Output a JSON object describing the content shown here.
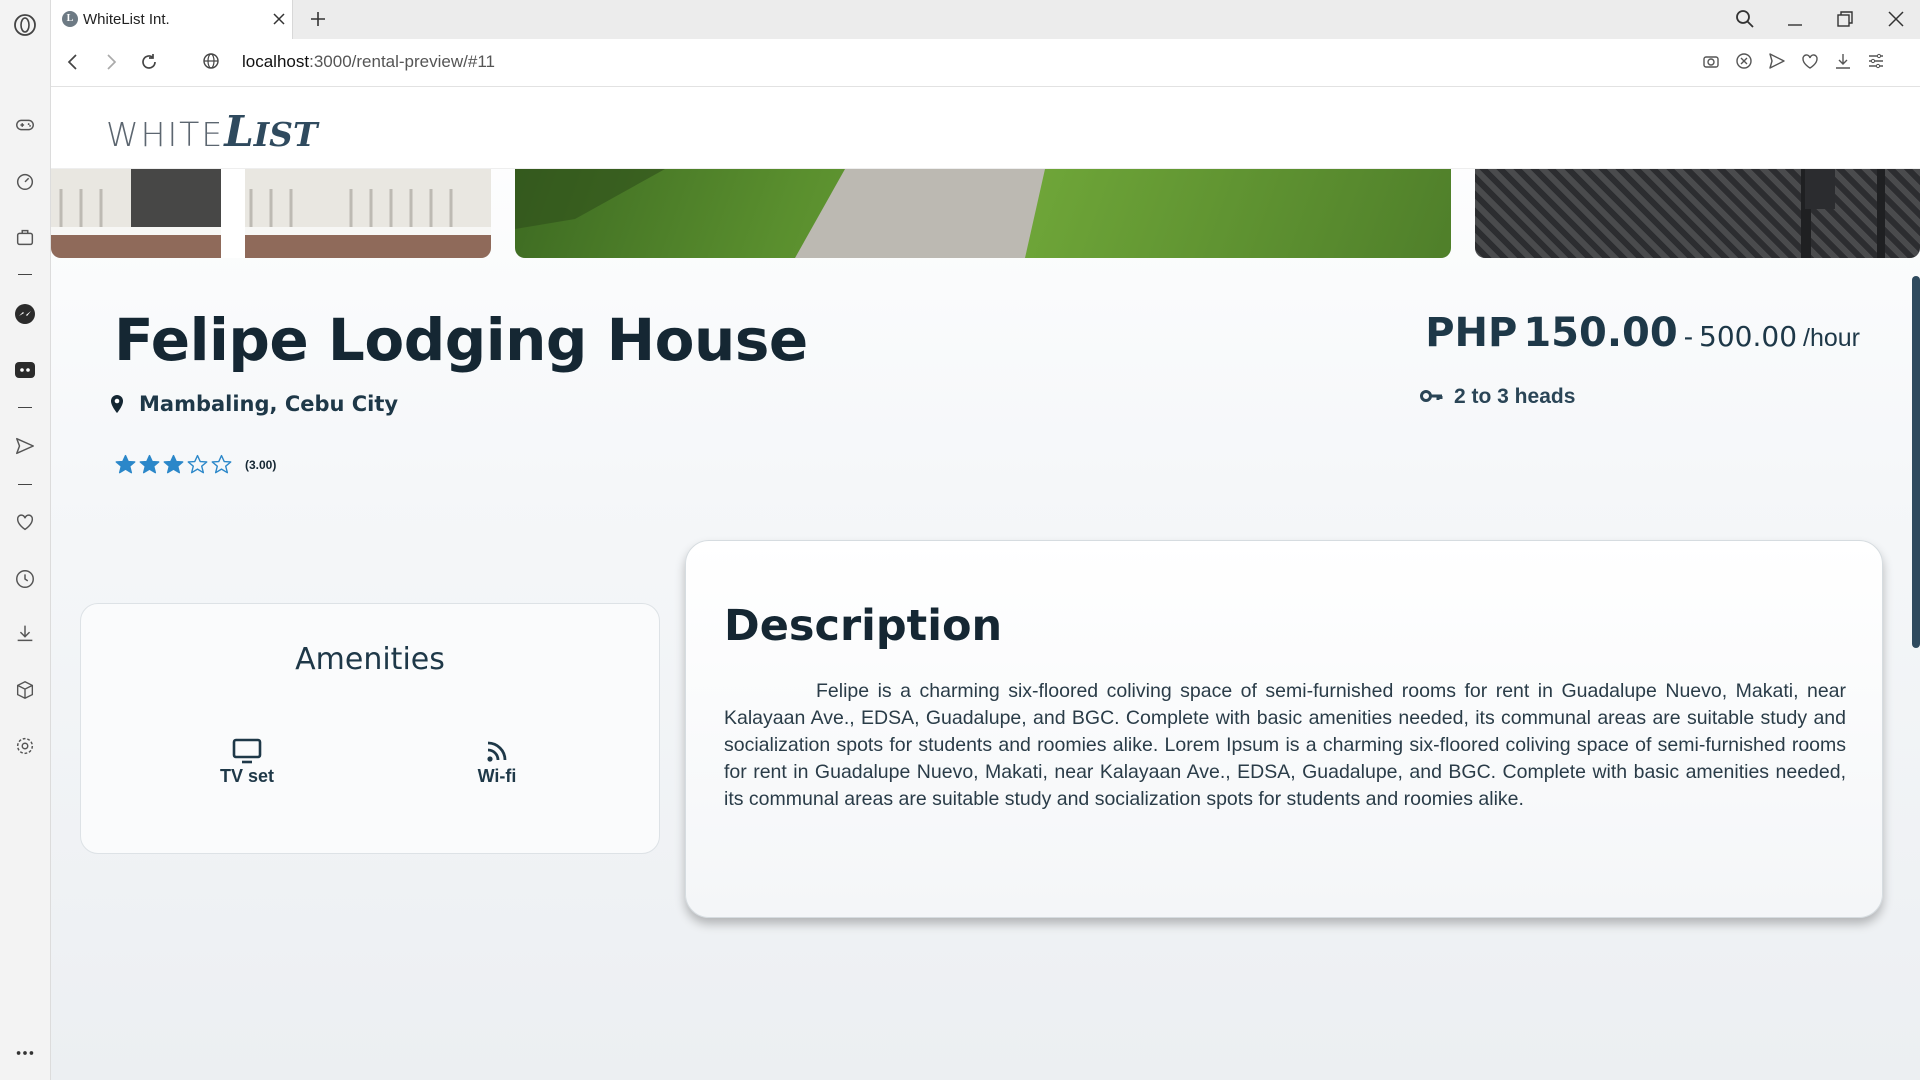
{
  "browser": {
    "tab_title": "WhiteList Int.",
    "url_host": "localhost",
    "url_path": ":3000/rental-preview/#11"
  },
  "site": {
    "logo_part1": "WHITE",
    "logo_part2": "L",
    "logo_part3": "IST"
  },
  "listing": {
    "title": "Felipe Lodging House",
    "location": "Mambaling, Cebu City",
    "rating_text": "(3.00)",
    "rating_value": 3,
    "rating_max": 5,
    "price_currency": "PHP",
    "price_min": "150.00",
    "price_sep": "-",
    "price_max": "500.00",
    "price_unit": "/hour",
    "heads": "2 to 3 heads"
  },
  "amenities": {
    "title": "Amenities",
    "items": [
      {
        "label": "TV set",
        "icon": "tv-icon"
      },
      {
        "label": "Wi-fi",
        "icon": "wifi-icon"
      }
    ]
  },
  "description": {
    "title": "Description",
    "text": "Felipe is a charming six-floored coliving space of semi-furnished rooms for rent in Guadalupe Nuevo, Makati, near Kalayaan Ave., EDSA, Guadalupe, and BGC. Complete with basic amenities needed, its communal areas are suitable study and socialization spots for students and roomies alike. Lorem Ipsum is a charming six-floored coliving space of semi-furnished rooms for rent in Guadalupe Nuevo, Makati, near Kalayaan Ave., EDSA, Guadalupe, and BGC. Complete with basic amenities needed, its communal areas are suitable study and socialization spots for students and roomies alike."
  },
  "colors": {
    "accent": "#1e3848",
    "star": "#2b87c9"
  }
}
